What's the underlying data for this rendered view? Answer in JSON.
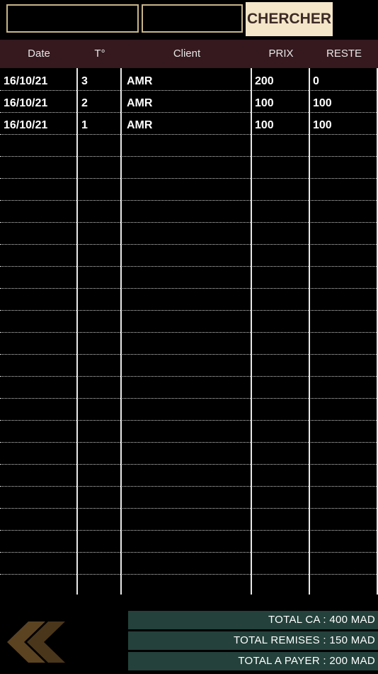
{
  "search": {
    "field1_value": "",
    "field2_value": "",
    "button_label": "CHERCHER"
  },
  "table": {
    "headers": [
      "Date",
      "T°",
      "Client",
      "PRIX",
      "RESTE"
    ],
    "rows": [
      {
        "date": "16/10/21",
        "t": "3",
        "client": "AMR",
        "prix": "200",
        "reste": "0"
      },
      {
        "date": "16/10/21",
        "t": "2",
        "client": "AMR",
        "prix": "100",
        "reste": "100"
      },
      {
        "date": "16/10/21",
        "t": "1",
        "client": "AMR",
        "prix": "100",
        "reste": "100"
      }
    ]
  },
  "totals": {
    "ca": "TOTAL CA : 400 MAD",
    "remises": "TOTAL REMISES : 150 MAD",
    "payer": "TOTAL A PAYER : 200 MAD"
  },
  "colors": {
    "background": "#000000",
    "header_bg": "#35191e",
    "button_bg": "#f4e6c8",
    "button_text": "#3c2a26",
    "totals_bg": "#24413b",
    "back_icon": "#5b4322"
  },
  "icons": {
    "back": "double-chevron-left-icon"
  }
}
